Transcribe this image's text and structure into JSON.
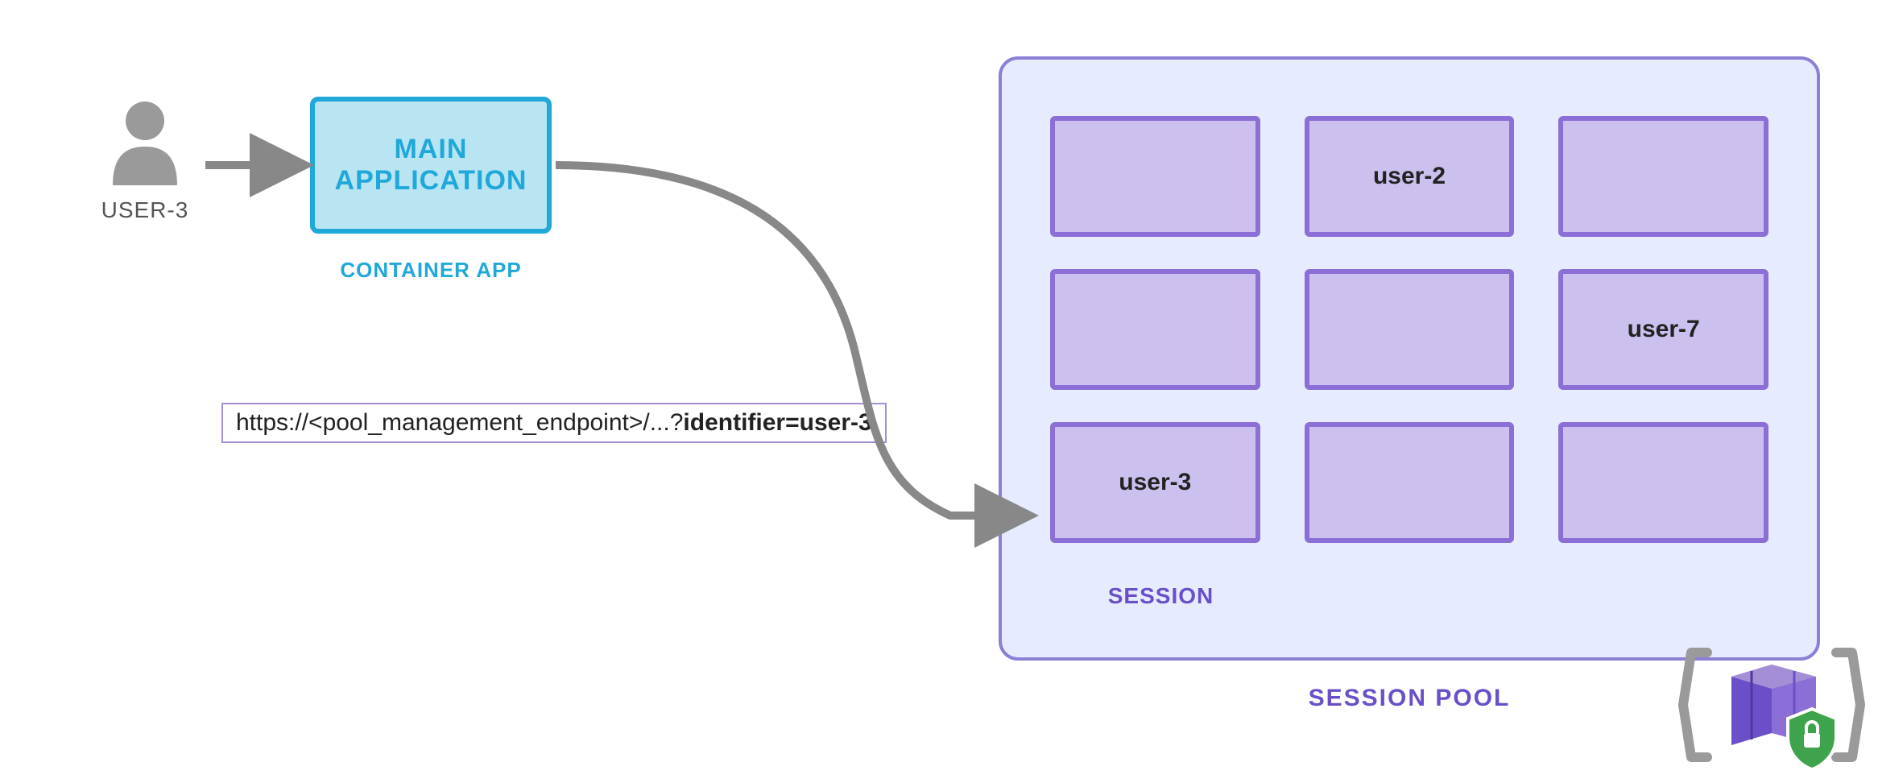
{
  "user": {
    "label": "USER-3"
  },
  "app": {
    "title_line1": "MAIN",
    "title_line2": "APPLICATION",
    "sublabel": "CONTAINER APP"
  },
  "url": {
    "prefix": "https://<pool_management_endpoint>/...?",
    "bold": "identifier=user-3"
  },
  "pool": {
    "session_label": "SESSION",
    "pool_label": "SESSION POOL",
    "sessions": [
      {
        "text": ""
      },
      {
        "text": "user-2"
      },
      {
        "text": ""
      },
      {
        "text": ""
      },
      {
        "text": ""
      },
      {
        "text": "user-7"
      },
      {
        "text": "user-3"
      },
      {
        "text": ""
      },
      {
        "text": ""
      }
    ]
  },
  "colors": {
    "app_border": "#1fa8d8",
    "app_fill": "#b9e5f3",
    "pool_border": "#8c7fd6",
    "pool_fill": "#e6ebff",
    "session_border": "#8b6fd6",
    "session_fill": "#cbc0ee",
    "arrow": "#888888",
    "purple_text": "#6a4fc8"
  }
}
